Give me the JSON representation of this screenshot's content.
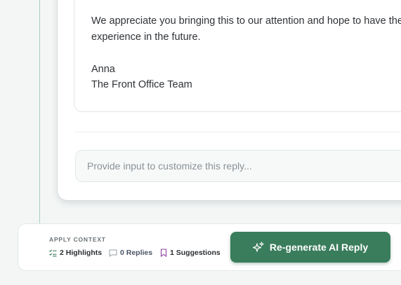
{
  "message": {
    "line1": "We appreciate you bringing this to our attention and hope to have the o",
    "line2": "experience in the future.",
    "signature_name": "Anna",
    "signature_team": "The Front Office Team"
  },
  "reply_input": {
    "placeholder": "Provide input to customize this reply..."
  },
  "context": {
    "label": "APPLY CONTEXT",
    "highlights": "2 Highlights",
    "replies": "0 Replies",
    "suggestions": "1 Suggestions"
  },
  "regenerate_button": {
    "label": "Re-generate AI Reply"
  },
  "colors": {
    "accent": "#3a7d5c",
    "highlights_icon": "#3a7d5c",
    "suggestions_icon": "#8e3fa0"
  },
  "icons": {
    "highlights": "checklist-icon",
    "replies": "comment-icon",
    "suggestions": "bookmark-icon",
    "regenerate": "sparkles-icon"
  }
}
